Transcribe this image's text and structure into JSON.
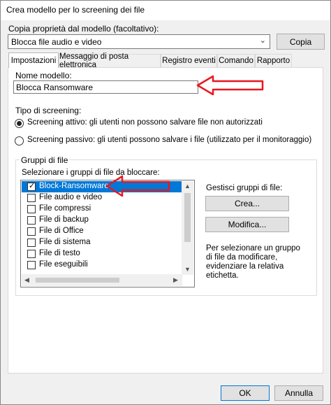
{
  "window": {
    "title": "Crea modello per lo screening dei file"
  },
  "copy": {
    "label": "Copia proprietà dal modello (facoltativo):",
    "selected": "Blocca file audio e video",
    "button": "Copia"
  },
  "tabs": [
    {
      "label": "Impostazioni",
      "active": true
    },
    {
      "label": "Messaggio di posta elettronica",
      "active": false
    },
    {
      "label": "Registro eventi",
      "active": false
    },
    {
      "label": "Comando",
      "active": false
    },
    {
      "label": "Rapporto",
      "active": false
    }
  ],
  "settings": {
    "name_label": "Nome modello:",
    "name_value": "Blocca Ransomware",
    "screening_type_label": "Tipo di screening:",
    "active_option": "Screening attivo: gli utenti non possono salvare file non autorizzati",
    "passive_option": "Screening passivo: gli utenti possono salvare i file (utilizzato per il monitoraggio)",
    "selected_option": "active"
  },
  "file_groups": {
    "group_title": "Gruppi di file",
    "select_label": "Selezionare i gruppi di file da bloccare:",
    "items": [
      {
        "label": "Block-Ransomware",
        "checked": true,
        "selected": true
      },
      {
        "label": "File audio e video",
        "checked": false,
        "selected": false
      },
      {
        "label": "File compressi",
        "checked": false,
        "selected": false
      },
      {
        "label": "File di backup",
        "checked": false,
        "selected": false
      },
      {
        "label": "File di Office",
        "checked": false,
        "selected": false
      },
      {
        "label": "File di sistema",
        "checked": false,
        "selected": false
      },
      {
        "label": "File di testo",
        "checked": false,
        "selected": false
      },
      {
        "label": "File eseguibili",
        "checked": false,
        "selected": false
      }
    ],
    "manage_label": "Gestisci gruppi di file:",
    "create_button": "Crea...",
    "edit_button": "Modifica...",
    "help_text": "Per selezionare un gruppo di file da modificare, evidenziare la relativa etichetta."
  },
  "footer": {
    "ok_button": "OK",
    "cancel_button": "Annulla"
  },
  "colors": {
    "accent": "#0078d7",
    "annotation": "#e8171f"
  }
}
